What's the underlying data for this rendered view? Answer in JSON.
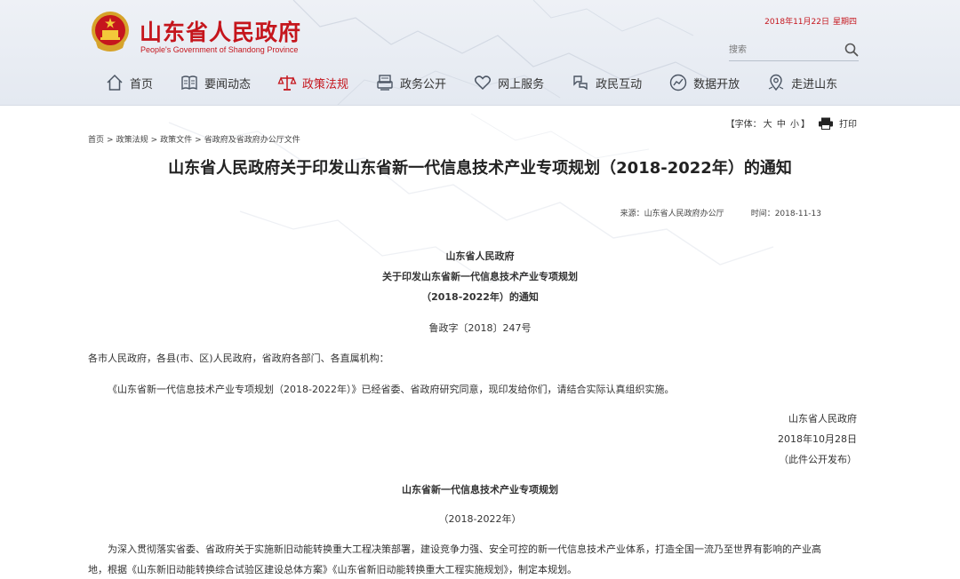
{
  "header": {
    "site_title": "山东省人民政府",
    "site_subtitle": "People's Government of Shandong Province",
    "date": "2018年11月22日",
    "weekday": "星期四",
    "search_placeholder": "搜索"
  },
  "nav": [
    {
      "label": "首页",
      "icon": "home-icon"
    },
    {
      "label": "要闻动态",
      "icon": "book-icon"
    },
    {
      "label": "政策法规",
      "icon": "scales-icon"
    },
    {
      "label": "政务公开",
      "icon": "printer-doc-icon"
    },
    {
      "label": "网上服务",
      "icon": "heart-icon"
    },
    {
      "label": "政民互动",
      "icon": "chat-icon"
    },
    {
      "label": "数据开放",
      "icon": "data-globe-icon"
    },
    {
      "label": "走进山东",
      "icon": "map-pin-icon"
    }
  ],
  "active_nav": "政策法规",
  "tools": {
    "font_prefix": "【字体：",
    "font_large": "大",
    "font_medium": "中",
    "font_small": "小",
    "font_suffix": "】",
    "print": "打印"
  },
  "breadcrumb": [
    "首页",
    "政策法规",
    "政策文件",
    "省政府及省政府办公厅文件"
  ],
  "article": {
    "title": "山东省人民政府关于印发山东省新一代信息技术产业专项规划（2018-2022年）的通知",
    "source": "来源：山东省人民政府办公厅",
    "time": "时间：2018-11-13",
    "head1": "山东省人民政府",
    "head2": "关于印发山东省新一代信息技术产业专项规划",
    "head3": "（2018-2022年）的通知",
    "doc_no": "鲁政字〔2018〕247号",
    "addressee": "各市人民政府，各县(市、区)人民政府，省政府各部门、各直属机构：",
    "body": "《山东省新一代信息技术产业专项规划（2018-2022年）》已经省委、省政府研究同意，现印发给你们，请结合实际认真组织实施。",
    "sign_org": "山东省人民政府",
    "sign_date": "2018年10月28日",
    "publish_note": "（此件公开发布）",
    "plan_title": "山东省新一代信息技术产业专项规划",
    "plan_years": "（2018-2022年）",
    "para1_line1": "为深入贯彻落实省委、省政府关于实施新旧动能转换重大工程决策部署，建设竞争力强、安全可控的新一代信息技术产业体系，打造全国一流乃至世界有影响的产业高",
    "para1_line2": "地，根据《山东新旧动能转换综合试验区建设总体方案》《山东省新旧动能转换重大工程实施规划》，制定本规划。"
  },
  "colors": {
    "brand_red": "#c5161d",
    "header_bg": "#e9edf3"
  }
}
